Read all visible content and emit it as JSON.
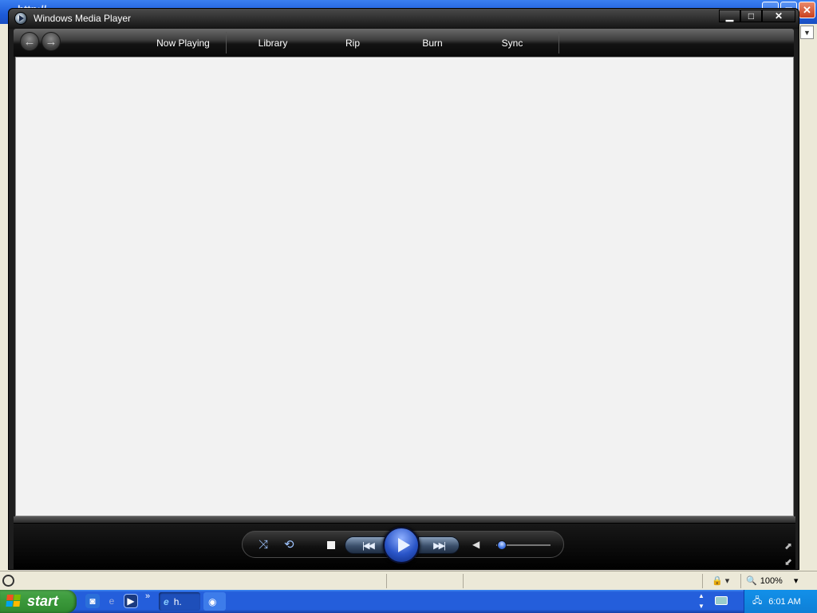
{
  "background_window": {
    "title": "http://...",
    "status_bar": {
      "zoom": "100%"
    }
  },
  "wmp": {
    "title": "Windows Media Player",
    "window_controls": {
      "minimize": "▁",
      "maximize": "□",
      "close": "✕"
    },
    "nav": {
      "back": "←",
      "forward": "→"
    },
    "tabs": [
      {
        "label": "Now Playing"
      },
      {
        "label": "Library"
      },
      {
        "label": "Rip"
      },
      {
        "label": "Burn"
      },
      {
        "label": "Sync"
      }
    ],
    "transport": {
      "shuffle": "shuffle-icon",
      "repeat": "repeat-icon",
      "previous": "|◀◀",
      "next": "▶▶|",
      "volume_level": 0.05
    }
  },
  "taskbar": {
    "start_label": "start",
    "quick_launch": [
      "ie-icon",
      "wmp-icon",
      "show-desktop-icon"
    ],
    "chevron": "»",
    "tasks": [
      {
        "label": "h.",
        "icon": "ie-icon"
      },
      {
        "label": "",
        "icon": "wmp-icon"
      }
    ],
    "clock": "6:01 AM"
  }
}
